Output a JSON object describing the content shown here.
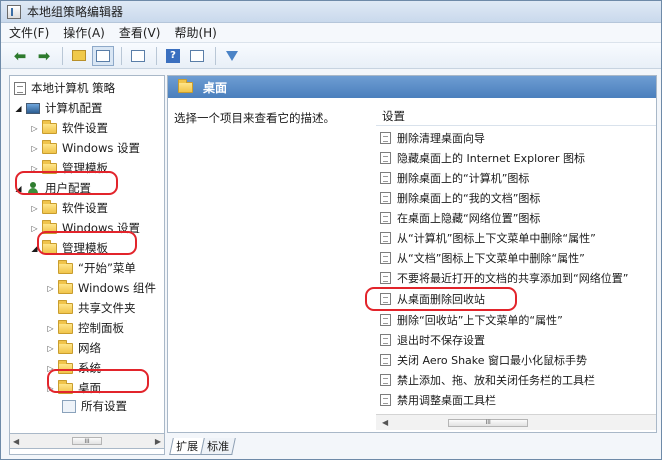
{
  "window": {
    "title": "本地组策略编辑器"
  },
  "menu": [
    "文件(F)",
    "操作(A)",
    "查看(V)",
    "帮助(H)"
  ],
  "tree": {
    "root": "本地计算机 策略",
    "computer_config": "计算机配置",
    "cc_software": "软件设置",
    "cc_windows": "Windows 设置",
    "cc_admin": "管理模板",
    "user_config": "用户配置",
    "uc_software": "软件设置",
    "uc_windows": "Windows 设置",
    "uc_admin": "管理模板",
    "start_menu": "“开始”菜单",
    "windows_components": "Windows 组件",
    "shared_folders": "共享文件夹",
    "control_panel": "控制面板",
    "network": "网络",
    "system": "系统",
    "desktop": "桌面",
    "all_settings": "所有设置"
  },
  "right": {
    "header": "桌面",
    "description": "选择一个项目来查看它的描述。",
    "column": "设置",
    "settings": [
      "删除清理桌面向导",
      "隐藏桌面上的 Internet Explorer 图标",
      "删除桌面上的“计算机”图标",
      "删除桌面上的“我的文档”图标",
      "在桌面上隐藏“网络位置”图标",
      "从“计算机”图标上下文菜单中删除“属性”",
      "从“文档”图标上下文菜单中删除“属性”",
      "不要将最近打开的文档的共享添加到“网络位置”",
      "从桌面删除回收站",
      "删除“回收站”上下文菜单的“属性”",
      "退出时不保存设置",
      "关闭 Aero Shake 窗口最小化鼠标手势",
      "禁止添加、拖、放和关闭任务栏的工具栏",
      "禁用调整桌面工具栏"
    ]
  },
  "tabs": [
    "扩展",
    "标准"
  ],
  "colors": {
    "highlight": "#e2242b",
    "header": "#4a7fbd"
  }
}
